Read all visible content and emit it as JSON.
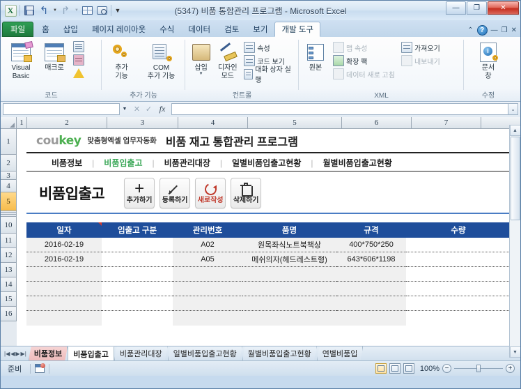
{
  "window": {
    "title": "(5347) 비품 통합관리 프로그램  -  Microsoft Excel",
    "qat": {
      "logo": "X",
      "save": "save-icon",
      "undo": "↰",
      "redo": "↱",
      "custom1": "grid-icon",
      "custom2": "camera-icon",
      "more": "▾"
    },
    "buttons": {
      "minimize": "—",
      "maximize": "❐",
      "close": "✕"
    }
  },
  "ribbon": {
    "tabs": [
      {
        "label": "파일",
        "kind": "file"
      },
      {
        "label": "홈",
        "kind": "normal"
      },
      {
        "label": "삽입",
        "kind": "normal"
      },
      {
        "label": "페이지 레이아웃",
        "kind": "normal"
      },
      {
        "label": "수식",
        "kind": "normal"
      },
      {
        "label": "데이터",
        "kind": "normal"
      },
      {
        "label": "검토",
        "kind": "normal"
      },
      {
        "label": "보기",
        "kind": "normal"
      },
      {
        "label": "개발 도구",
        "kind": "active"
      }
    ],
    "right": {
      "collapse": "⌃",
      "help": "?",
      "minimize": "—",
      "restore": "❐",
      "close": "✕"
    },
    "groups": [
      {
        "name": "코드",
        "items": [
          {
            "label": "Visual\nBasic",
            "line1": "Visual",
            "line2": "Basic",
            "icon": "visual-basic-icon"
          },
          {
            "label": "매크로",
            "line1": "매크로",
            "line2": "",
            "icon": "macro-icon"
          },
          {
            "label": "매크로 기록",
            "icon": "record-macro-icon",
            "small": true
          },
          {
            "label": "상대 참조로 기록",
            "icon": "relative-reference-icon",
            "small": true
          },
          {
            "label": "매크로 보안",
            "icon": "macro-security-icon",
            "small": true
          }
        ]
      },
      {
        "name": "추가 기능",
        "items": [
          {
            "line1": "추가",
            "line2": "기능",
            "icon": "add-ins-icon"
          },
          {
            "line1": "COM",
            "line2": "추가 기능",
            "icon": "com-add-ins-icon"
          }
        ]
      },
      {
        "name": "컨트롤",
        "items": [
          {
            "line1": "삽입",
            "line2": "",
            "icon": "insert-control-icon",
            "hasCaret": true
          },
          {
            "line1": "디자인",
            "line2": "모드",
            "icon": "design-mode-icon"
          },
          {
            "label": "속성",
            "icon": "properties-icon",
            "small": true,
            "dim": false
          },
          {
            "label": "코드 보기",
            "icon": "view-code-icon",
            "small": true,
            "dim": false
          },
          {
            "label": "대화 상자 실행",
            "icon": "run-dialog-icon",
            "small": true,
            "dim": false
          }
        ]
      },
      {
        "name": "XML",
        "items": [
          {
            "line1": "원본",
            "line2": "",
            "icon": "xml-source-icon"
          },
          {
            "label": "맵 속성",
            "icon": "map-properties-icon",
            "small": true,
            "dim": true
          },
          {
            "label": "확장 팩",
            "icon": "expansion-packs-icon",
            "small": true,
            "dim": false
          },
          {
            "label": "데이터 새로 고침",
            "icon": "refresh-data-icon",
            "small": true,
            "dim": true
          },
          {
            "label": "가져오기",
            "icon": "import-icon",
            "small": true,
            "dim": false
          },
          {
            "label": "내보내기",
            "icon": "export-icon",
            "small": true,
            "dim": true
          }
        ]
      },
      {
        "name": "수정",
        "items": [
          {
            "line1": "문서",
            "line2": "창",
            "line3": "",
            "icon": "document-panel-icon"
          }
        ]
      }
    ]
  },
  "formula_bar": {
    "name_box_value": "",
    "formula_value": "",
    "fx_label": "fx",
    "cancel": "✕",
    "accept": "✓",
    "expand": "⌄"
  },
  "grid": {
    "reference_style": "R1C1",
    "column_headers": [
      "1",
      "2",
      "3",
      "4",
      "5",
      "6",
      "7"
    ],
    "row_headers": [
      "1",
      "2",
      "3",
      "4",
      "5",
      "10",
      "11",
      "12",
      "13",
      "14",
      "15",
      "16"
    ],
    "selected_row": "5",
    "hidden_rows_between": "6-9"
  },
  "sheet": {
    "logo": {
      "part1": "cou",
      "part2": "key",
      "tagline": "맞춤형엑셀 업무자동화"
    },
    "document_title": "비품 재고 통합관리 프로그램",
    "nav": [
      {
        "label": "비품정보",
        "active": false
      },
      {
        "label": "비품입출고",
        "active": true
      },
      {
        "label": "비품관리대장",
        "active": false
      },
      {
        "label": "일별비품입출고현황",
        "active": false
      },
      {
        "label": "월별비품입출고현황",
        "active": false
      }
    ],
    "nav_separator": "|",
    "page_title": "비품입출고",
    "action_buttons": [
      {
        "label": "추가하기",
        "icon": "plus-icon",
        "red": false
      },
      {
        "label": "등록하기",
        "icon": "pencil-icon",
        "red": false
      },
      {
        "label": "새로작성",
        "icon": "refresh-icon",
        "red": true
      },
      {
        "label": "삭제하기",
        "icon": "trash-icon",
        "red": false
      }
    ],
    "table": {
      "headers": [
        "일자",
        "입출고 구분",
        "관리번호",
        "품명",
        "규격",
        "수량"
      ],
      "header_comment_on": "일자",
      "rows": [
        {
          "일자": "2016-02-19",
          "입출고 구분": "",
          "관리번호": "A02",
          "품명": "원목좌식노트북책상",
          "규격": "400*750*250",
          "수량": ""
        },
        {
          "일자": "2016-02-19",
          "입출고 구분": "",
          "관리번호": "A05",
          "품명": "메쉬의자(헤드레스트형)",
          "규격": "643*606*1198",
          "수량": ""
        },
        {
          "일자": "",
          "입출고 구분": "",
          "관리번호": "",
          "품명": "",
          "규격": "",
          "수량": ""
        },
        {
          "일자": "",
          "입출고 구분": "",
          "관리번호": "",
          "품명": "",
          "규격": "",
          "수량": ""
        },
        {
          "일자": "",
          "입출고 구분": "",
          "관리번호": "",
          "품명": "",
          "규격": "",
          "수량": ""
        },
        {
          "일자": "",
          "입출고 구분": "",
          "관리번호": "",
          "품명": "",
          "규격": "",
          "수량": ""
        }
      ]
    },
    "colors": {
      "header_blue": "#1f4e9b",
      "accent_green": "#3aa757",
      "accent_red": "#c0392b",
      "divider_blue": "#4a7dc4"
    }
  },
  "sheet_tabs": {
    "nav_buttons": [
      "|◀",
      "◀",
      "▶",
      "▶|"
    ],
    "tabs": [
      {
        "label": "비품정보",
        "state": "colored"
      },
      {
        "label": "비품입출고",
        "state": "active"
      },
      {
        "label": "비품관리대장",
        "state": "normal"
      },
      {
        "label": "일별비품입출고현황",
        "state": "normal"
      },
      {
        "label": "월별비품입출고현황",
        "state": "normal"
      },
      {
        "label": "연별비품입",
        "state": "normal"
      }
    ],
    "scroll": [
      "◀",
      "▶"
    ]
  },
  "status_bar": {
    "status": "준비",
    "macro_record_icon": "record-macro-icon",
    "views": [
      {
        "name": "normal-view",
        "active": true
      },
      {
        "name": "page-layout-view",
        "active": false
      },
      {
        "name": "page-break-view",
        "active": false
      }
    ],
    "zoom": "100%",
    "zoom_out": "−",
    "zoom_in": "+"
  }
}
